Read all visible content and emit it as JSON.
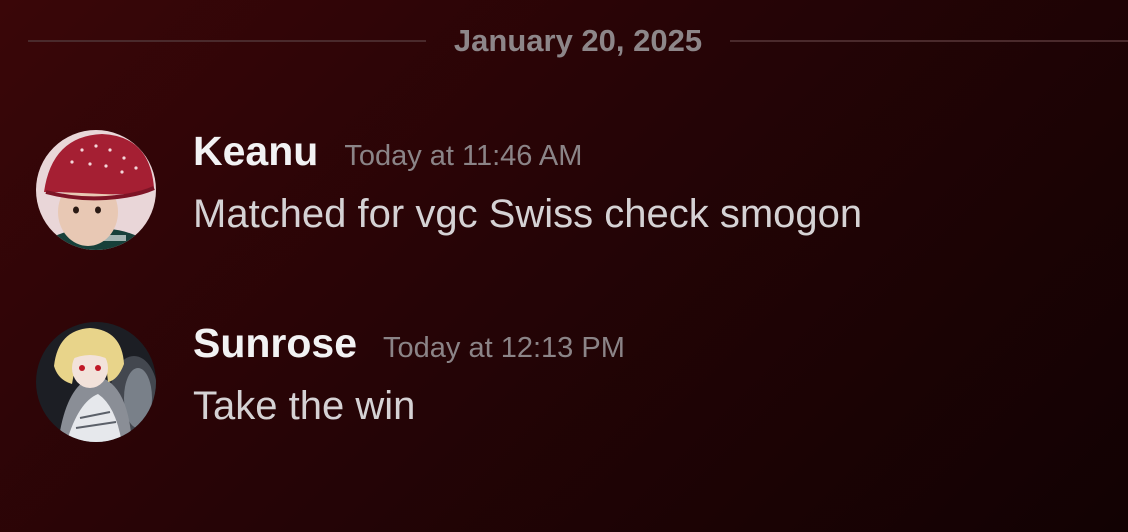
{
  "date_divider": "January 20, 2025",
  "messages": [
    {
      "author": "Keanu",
      "timestamp": "Today at 11:46 AM",
      "text": "Matched for vgc Swiss check smogon"
    },
    {
      "author": "Sunrose",
      "timestamp": "Today at 12:13 PM",
      "text": "Take the win"
    }
  ],
  "colors": {
    "background_start": "#3a0608",
    "background_end": "#120203",
    "username": "#f2f2f3",
    "timestamp": "#8b8487",
    "message_text": "#d5d2d4",
    "divider_line": "#4a2a2c"
  }
}
